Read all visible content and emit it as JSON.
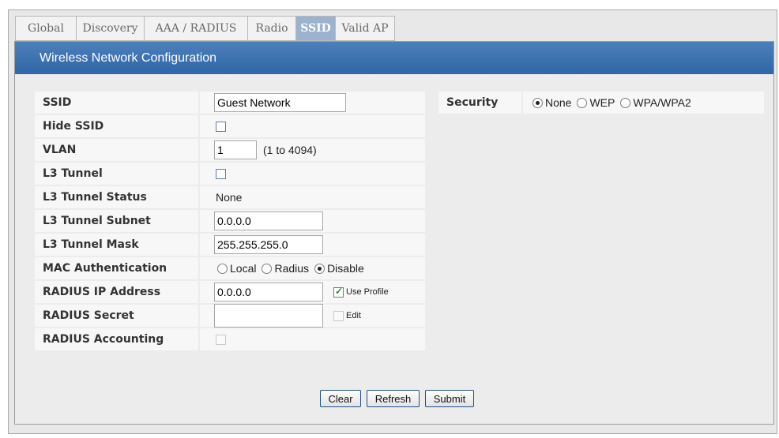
{
  "tabs": [
    {
      "label": "Global"
    },
    {
      "label": "Discovery"
    },
    {
      "label": "AAA / RADIUS"
    },
    {
      "label": "Radio"
    },
    {
      "label": "SSID",
      "active": true
    },
    {
      "label": "Valid AP"
    }
  ],
  "header": {
    "title": "Wireless Network Configuration"
  },
  "form": {
    "ssid": {
      "label": "SSID",
      "value": "Guest Network"
    },
    "hide_ssid": {
      "label": "Hide SSID",
      "checked": false
    },
    "vlan": {
      "label": "VLAN",
      "value": "1",
      "hint": "(1 to 4094)"
    },
    "l3_tunnel": {
      "label": "L3 Tunnel",
      "checked": false
    },
    "l3_tunnel_status": {
      "label": "L3 Tunnel Status",
      "value": "None"
    },
    "l3_tunnel_subnet": {
      "label": "L3 Tunnel Subnet",
      "value": "0.0.0.0"
    },
    "l3_tunnel_mask": {
      "label": "L3 Tunnel Mask",
      "value": "255.255.255.0"
    },
    "mac_auth": {
      "label": "MAC Authentication",
      "options": [
        "Local",
        "Radius",
        "Disable"
      ],
      "selected": "Disable"
    },
    "radius_ip": {
      "label": "RADIUS IP Address",
      "value": "0.0.0.0",
      "use_profile_label": "Use Profile",
      "use_profile_checked": true
    },
    "radius_secret": {
      "label": "RADIUS Secret",
      "value": "",
      "edit_label": "Edit",
      "edit_checked": false
    },
    "radius_accounting": {
      "label": "RADIUS Accounting",
      "checked": false
    }
  },
  "security": {
    "label": "Security",
    "options": [
      "None",
      "WEP",
      "WPA/WPA2"
    ],
    "selected": "None"
  },
  "buttons": {
    "clear": "Clear",
    "refresh": "Refresh",
    "submit": "Submit"
  }
}
